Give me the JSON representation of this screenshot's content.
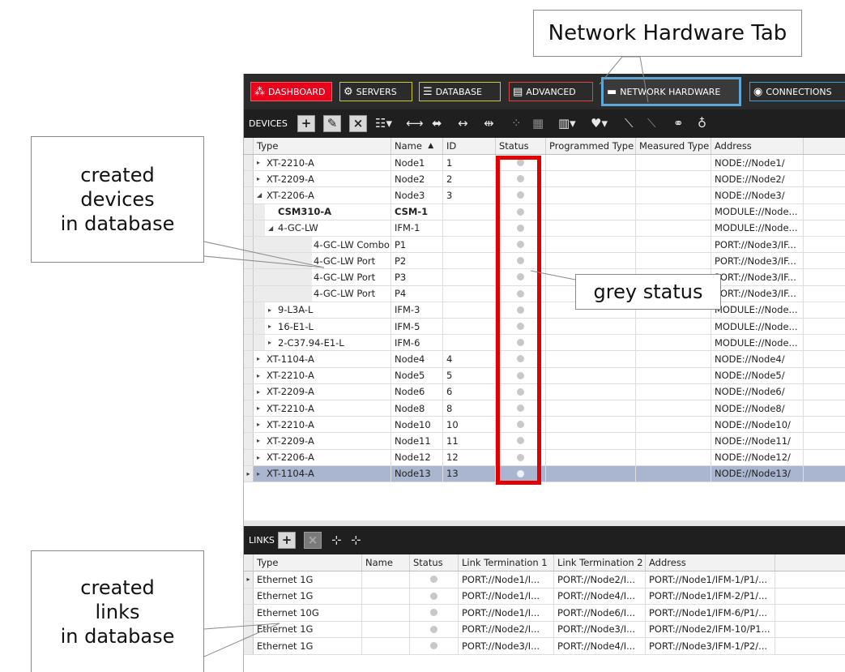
{
  "callouts": {
    "network_tab": "Network Hardware Tab",
    "devices": "created\ndevices\nin database",
    "grey_status": "grey status",
    "links": "created\nlinks\nin database"
  },
  "nav": {
    "dashboard": "DASHBOARD",
    "servers": "SERVERS",
    "database": "DATABASE",
    "advanced": "ADVANCED",
    "network_hardware": "NETWORK HARDWARE",
    "connections": "CONNECTIONS"
  },
  "devices_toolbar": {
    "label": "DEVICES"
  },
  "links_toolbar": {
    "label": "LINKS"
  },
  "device_columns": {
    "type": "Type",
    "name": "Name",
    "name_sort": "▲",
    "id": "ID",
    "status": "Status",
    "programmed_type": "Programmed Type",
    "measured_type": "Measured Type",
    "address": "Address"
  },
  "device_rows": [
    {
      "type": "XT-2210-A",
      "name": "Node1",
      "id": "1",
      "address": "NODE://Node1/"
    },
    {
      "type": "XT-2209-A",
      "name": "Node2",
      "id": "2",
      "address": "NODE://Node2/"
    },
    {
      "type": "XT-2206-A",
      "name": "Node3",
      "id": "3",
      "address": "NODE://Node3/"
    },
    {
      "type": "CSM310-A",
      "name": "CSM-1",
      "id": "",
      "address": "MODULE://Node..."
    },
    {
      "type": "4-GC-LW",
      "name": "IFM-1",
      "id": "",
      "address": "MODULE://Node..."
    },
    {
      "type": "4-GC-LW Combo",
      "name": "P1",
      "id": "",
      "address": "PORT://Node3/IF..."
    },
    {
      "type": "4-GC-LW Port",
      "name": "P2",
      "id": "",
      "address": "PORT://Node3/IF..."
    },
    {
      "type": "4-GC-LW Port",
      "name": "P3",
      "id": "",
      "address": "PORT://Node3/IF..."
    },
    {
      "type": "4-GC-LW Port",
      "name": "P4",
      "id": "",
      "address": "PORT://Node3/IF..."
    },
    {
      "type": "9-L3A-L",
      "name": "IFM-3",
      "id": "",
      "address": "MODULE://Node..."
    },
    {
      "type": "16-E1-L",
      "name": "IFM-5",
      "id": "",
      "address": "MODULE://Node..."
    },
    {
      "type": "2-C37.94-E1-L",
      "name": "IFM-6",
      "id": "",
      "address": "MODULE://Node..."
    },
    {
      "type": "XT-1104-A",
      "name": "Node4",
      "id": "4",
      "address": "NODE://Node4/"
    },
    {
      "type": "XT-2210-A",
      "name": "Node5",
      "id": "5",
      "address": "NODE://Node5/"
    },
    {
      "type": "XT-2209-A",
      "name": "Node6",
      "id": "6",
      "address": "NODE://Node6/"
    },
    {
      "type": "XT-2210-A",
      "name": "Node8",
      "id": "8",
      "address": "NODE://Node8/"
    },
    {
      "type": "XT-2210-A",
      "name": "Node10",
      "id": "10",
      "address": "NODE://Node10/"
    },
    {
      "type": "XT-2209-A",
      "name": "Node11",
      "id": "11",
      "address": "NODE://Node11/"
    },
    {
      "type": "XT-2206-A",
      "name": "Node12",
      "id": "12",
      "address": "NODE://Node12/"
    },
    {
      "type": "XT-1104-A",
      "name": "Node13",
      "id": "13",
      "address": "NODE://Node13/"
    }
  ],
  "link_columns": {
    "type": "Type",
    "name": "Name",
    "status": "Status",
    "term1": "Link Termination 1",
    "term2": "Link Termination 2",
    "address": "Address"
  },
  "link_rows": [
    {
      "type": "Ethernet 1G",
      "name": "",
      "term1": "PORT://Node1/I...",
      "term2": "PORT://Node2/I...",
      "address": "PORT://Node1/IFM-1/P1/..."
    },
    {
      "type": "Ethernet 1G",
      "name": "",
      "term1": "PORT://Node1/I...",
      "term2": "PORT://Node4/I...",
      "address": "PORT://Node1/IFM-2/P1/..."
    },
    {
      "type": "Ethernet 10G",
      "name": "",
      "term1": "PORT://Node1/I...",
      "term2": "PORT://Node6/I...",
      "address": "PORT://Node1/IFM-6/P1/..."
    },
    {
      "type": "Ethernet 1G",
      "name": "",
      "term1": "PORT://Node2/I...",
      "term2": "PORT://Node3/I...",
      "address": "PORT://Node2/IFM-10/P1..."
    },
    {
      "type": "Ethernet 1G",
      "name": "",
      "term1": "PORT://Node3/I...",
      "term2": "PORT://Node4/I...",
      "address": "PORT://Node3/IFM-1/P2/..."
    }
  ],
  "colors": {
    "highlight_box": "#e00000",
    "dashboard_tab": "#e8001c",
    "network_tab_border": "#5da6d6",
    "selected_row": "#aab5cf",
    "status_dot": "#c8c8c8"
  },
  "icons": {
    "dashboard": "dashboard-icon",
    "servers": "gear-icon",
    "database": "database-icon",
    "advanced": "document-icon",
    "network": "network-hardware-icon",
    "connections": "connections-icon"
  }
}
